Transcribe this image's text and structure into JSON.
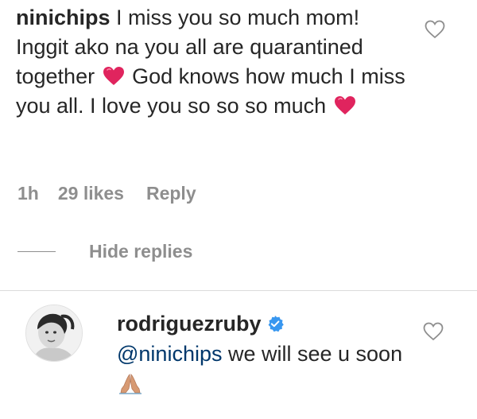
{
  "comment": {
    "username": "ninichips",
    "text_part1": " I miss you so much mom! Inggit ako na you all are quarantined together ",
    "text_part2": " God knows how much I miss you all. I love you so so so much ",
    "heart_emoji_name": "red-heart-emoji",
    "heart_color": "#e0245e",
    "like_icon_name": "heart-outline-icon",
    "meta": {
      "time": "1h",
      "likes": "29 likes",
      "reply": "Reply"
    }
  },
  "replies_toggle": {
    "label": "Hide replies"
  },
  "reply": {
    "avatar_icon_name": "user-avatar",
    "username": "rodriguezruby",
    "verified_icon_name": "verified-badge-icon",
    "verified_color": "#3897f0",
    "mention": "@ninichips",
    "text": " we will see u soon",
    "emoji_name": "folded-hands-emoji",
    "like_icon_name": "heart-outline-icon"
  },
  "colors": {
    "text": "#262626",
    "secondary": "#8e8e8e",
    "link": "#00376b",
    "divider": "#dbdbdb"
  }
}
